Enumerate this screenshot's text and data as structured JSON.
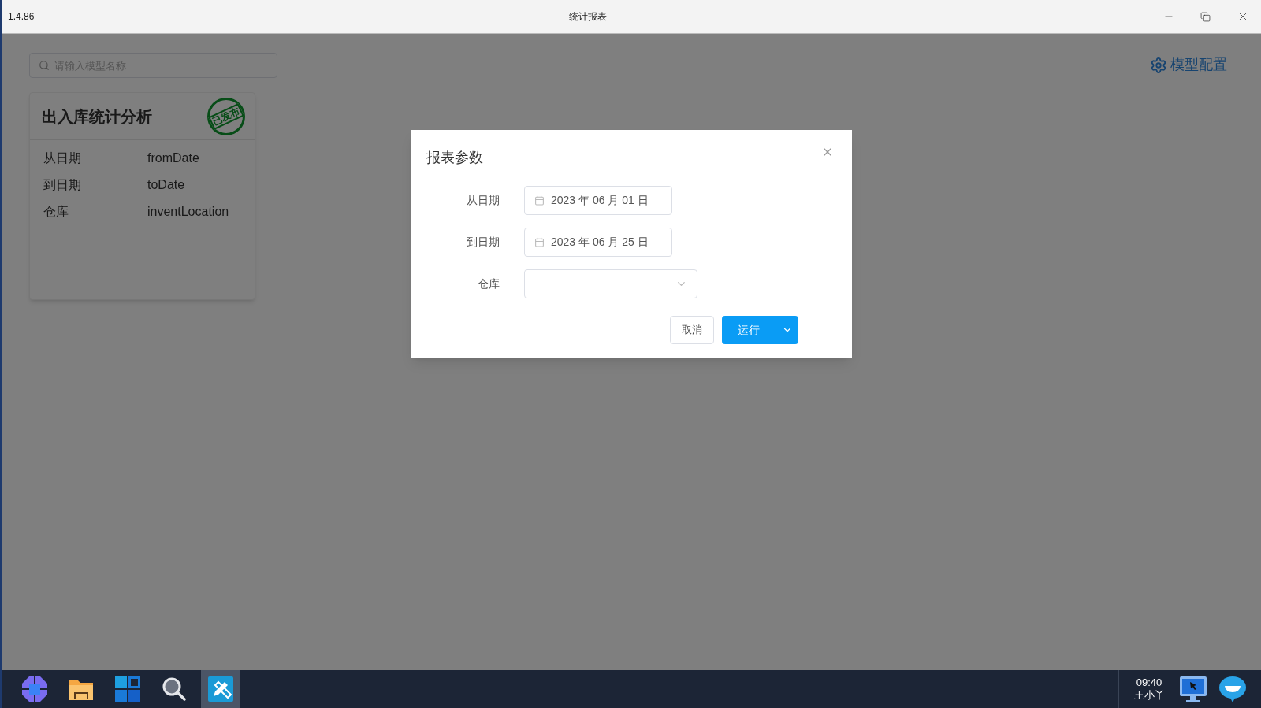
{
  "window": {
    "version": "1.4.86",
    "title": "统计报表"
  },
  "search": {
    "placeholder": "请输入模型名称"
  },
  "settings_link": "模型配置",
  "cards": [
    {
      "title": "出入库统计分析",
      "stamp": "已发布",
      "params": [
        {
          "label": "从日期",
          "name": "fromDate"
        },
        {
          "label": "到日期",
          "name": "toDate"
        },
        {
          "label": "仓库",
          "name": "inventLocation"
        }
      ]
    }
  ],
  "dialog": {
    "title": "报表参数",
    "fields": [
      {
        "kind": "date",
        "label": "从日期",
        "value": "2023 年 06 月 01 日"
      },
      {
        "kind": "date",
        "label": "到日期",
        "value": "2023 年 06 月 25 日"
      },
      {
        "kind": "select",
        "label": "仓库"
      }
    ],
    "cancel": "取消",
    "run": "运行"
  },
  "taskbar": {
    "time": "09:40",
    "user": "王小丫",
    "apps": [
      {
        "kind": "launcher",
        "selected": false
      },
      {
        "kind": "folder",
        "selected": false
      },
      {
        "kind": "windows",
        "selected": false
      },
      {
        "kind": "search",
        "selected": false
      },
      {
        "kind": "design",
        "selected": true
      }
    ]
  }
}
